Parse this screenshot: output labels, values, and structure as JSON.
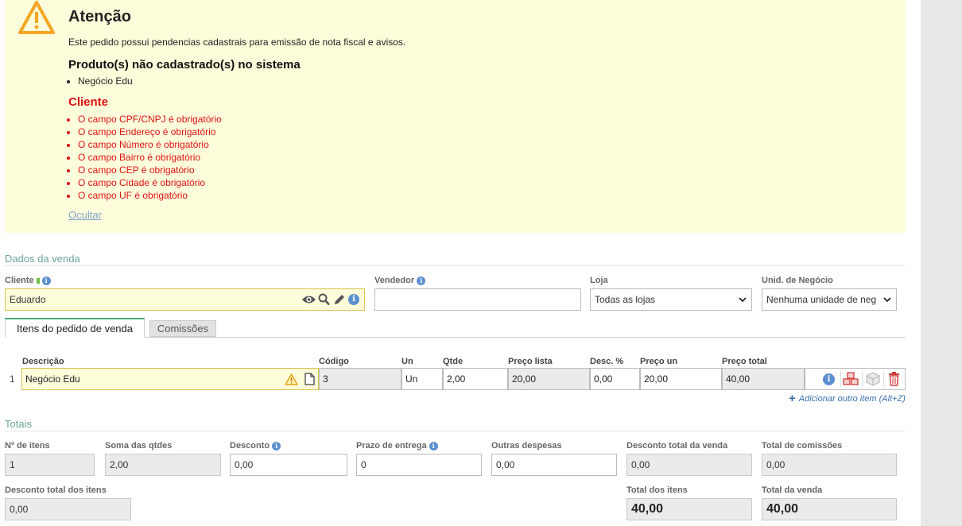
{
  "alert": {
    "title": "Atenção",
    "message": "Este pedido possui pendencias cadastrais para emissão de nota fiscal e avisos.",
    "products_heading": "Produto(s) não cadastrado(s) no sistema",
    "products": [
      "Negócio Edu"
    ],
    "client_heading": "Cliente",
    "client_errors": [
      "O campo CPF/CNPJ é obrigatório",
      "O campo Endereço é obrigatório",
      "O campo Número é obrigatório",
      "O campo Bairro é obrigatório",
      "O campo CEP é obrigatório",
      "O campo Cidade é obrigatório",
      "O campo UF é obrigatório"
    ],
    "hide_link": "Ocultar"
  },
  "sale": {
    "section_title": "Dados da venda",
    "client_label": "Cliente",
    "client_value": "Eduardo",
    "seller_label": "Vendedor",
    "seller_value": "",
    "store_label": "Loja",
    "store_value": "Todas as lojas",
    "unit_label": "Unid. de Negócio",
    "unit_value": "Nenhuma unidade de neg"
  },
  "tabs": {
    "items": "Itens do pedido de venda",
    "commissions": "Comissões"
  },
  "items_table": {
    "headers": {
      "description": "Descrição",
      "code": "Código",
      "unit": "Un",
      "qty": "Qtde",
      "list_price": "Preço lista",
      "discount": "Desc. %",
      "unit_price": "Preço un",
      "total": "Preço total"
    },
    "rows": [
      {
        "num": "1",
        "description": "Negócio Edu",
        "code": "3",
        "unit": "Un",
        "qty": "2,00",
        "list_price": "20,00",
        "discount": "0,00",
        "unit_price": "20,00",
        "total": "40,00"
      }
    ],
    "add_item": "Adicionar outro item (Alt+Z)"
  },
  "totals": {
    "section_title": "Totais",
    "num_items_label": "Nº de itens",
    "num_items": "1",
    "sum_qty_label": "Soma das qtdes",
    "sum_qty": "2,00",
    "discount_label": "Desconto",
    "discount": "0,00",
    "delivery_label": "Prazo de entrega",
    "delivery": "0",
    "other_expenses_label": "Outras despesas",
    "other_expenses": "0,00",
    "total_discount_label": "Desconto total da venda",
    "total_discount": "0,00",
    "total_commissions_label": "Total de comissões",
    "total_commissions": "0,00",
    "items_discount_label": "Desconto total dos itens",
    "items_discount": "0,00",
    "items_total_label": "Total dos itens",
    "items_total": "40,00",
    "sale_total_label": "Total da venda",
    "sale_total": "40,00"
  },
  "colors": {
    "alert_bg": "#fdfddc",
    "error_red": "#dd1111",
    "section_green": "#6aa59a",
    "link_blue": "#3a70b0",
    "info_blue": "#5b8fcf"
  }
}
